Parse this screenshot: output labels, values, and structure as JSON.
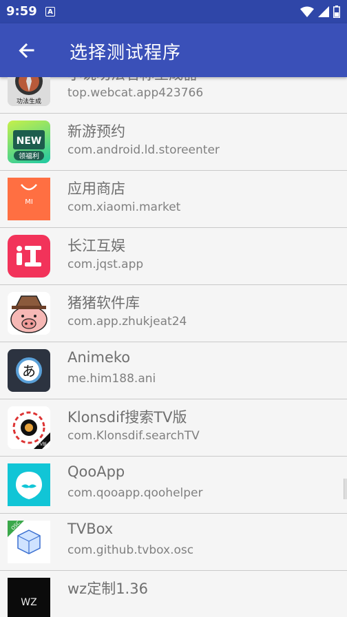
{
  "status_bar": {
    "time": "9:59",
    "notification_letter": "A"
  },
  "app_bar": {
    "title": "选择测试程序"
  },
  "apps": [
    {
      "name": "小说功法名称生成器",
      "package": "top.webcat.app423766",
      "icon": "compass-icon",
      "icon_text": "功法生成"
    },
    {
      "name": "新游预约",
      "package": "com.android.ld.storeenter",
      "icon": "new-game-icon",
      "icon_text": "NEW",
      "icon_subtext": "领福利"
    },
    {
      "name": "应用商店",
      "package": "com.xiaomi.market",
      "icon": "mi-store-icon",
      "icon_text": "MI"
    },
    {
      "name": "长江互娱",
      "package": "com.jqst.app",
      "icon": "changjiang-icon",
      "icon_text": "I"
    },
    {
      "name": "猪猪软件库",
      "package": "com.app.zhukjeat24",
      "icon": "pig-icon"
    },
    {
      "name": "Animeko",
      "package": "me.him188.ani",
      "icon": "animeko-icon",
      "icon_text": "あ"
    },
    {
      "name": "Klonsdif搜索TV版",
      "package": "com.Klonsdif.searchTV",
      "icon": "search-tv-icon",
      "icon_text": "TV版"
    },
    {
      "name": "QooApp",
      "package": "com.qooapp.qoohelper",
      "icon": "qooapp-icon"
    },
    {
      "name": "TVBox",
      "package": "com.github.tvbox.osc",
      "icon": "tvbox-icon",
      "icon_text": "OSC"
    },
    {
      "name": "wz定制1.36",
      "package": "",
      "icon": "wz-icon",
      "icon_text": "WZ"
    }
  ],
  "colors": {
    "status_bar": "#2f46a8",
    "app_bar": "#3a50b8",
    "background": "#f5f5f5"
  }
}
